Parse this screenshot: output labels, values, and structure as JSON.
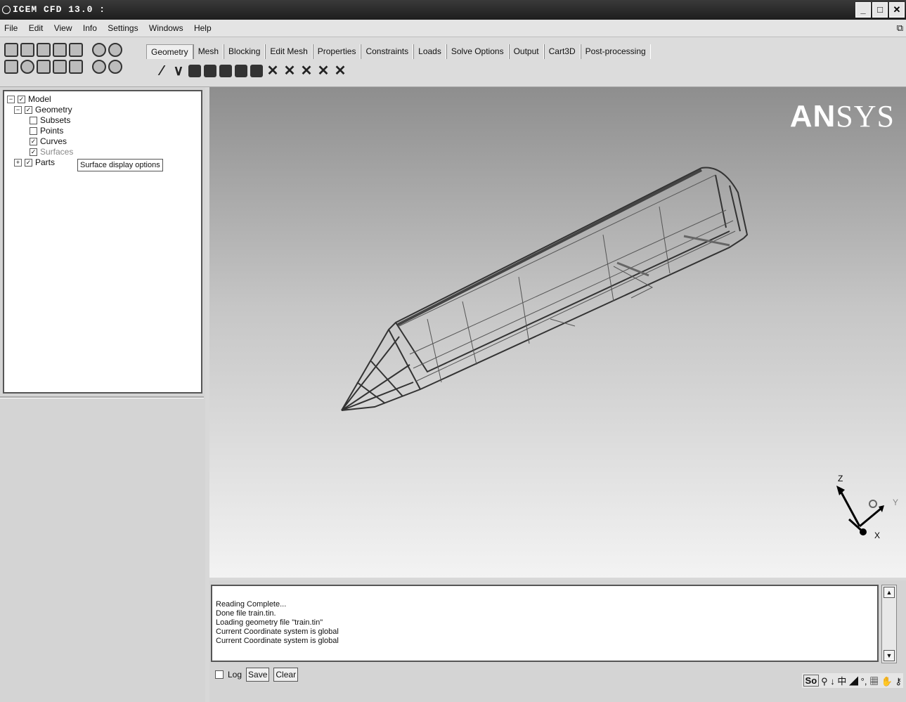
{
  "window": {
    "title": "ICEM CFD 13.0 :",
    "buttons": [
      "_",
      "□",
      "✕"
    ]
  },
  "menu": [
    "File",
    "Edit",
    "View",
    "Info",
    "Settings",
    "Windows",
    "Help"
  ],
  "tabs": [
    "Geometry",
    "Mesh",
    "Blocking",
    "Edit Mesh",
    "Properties",
    "Constraints",
    "Loads",
    "Solve Options",
    "Output",
    "Cart3D",
    "Post-processing"
  ],
  "tree": {
    "model": "Model",
    "geometry": "Geometry",
    "subsets": "Subsets",
    "points": "Points",
    "curves": "Curves",
    "surfaces": "Surfaces",
    "parts": "Parts",
    "tooltip": "Surface display options"
  },
  "viewport": {
    "logo": {
      "prefix": "AN",
      "suffix": "SYS"
    },
    "axes": {
      "z": "Z",
      "y": "Y",
      "x": "X"
    }
  },
  "console": {
    "lines": [
      "Reading Complete...",
      "Done file train.tin.",
      "Loading geometry file \"train.tin\"",
      "Current Coordinate system is global",
      "Current Coordinate system is global"
    ],
    "log_label": "Log",
    "save_label": "Save",
    "clear_label": "Clear"
  },
  "ime": {
    "label": "So",
    "symbols": "⚲ ↓ 中 ◢ °, ▦ ✋ ⚷"
  }
}
